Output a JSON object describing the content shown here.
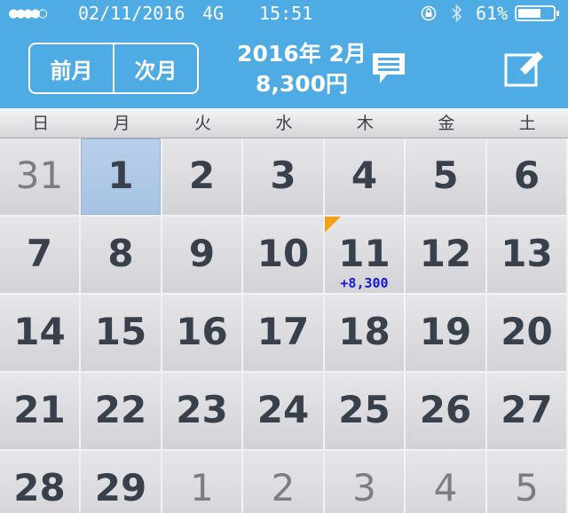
{
  "status_bar": {
    "signal": "●●●●○",
    "date": "02/11/2016",
    "network": "4G",
    "time": "15:51",
    "battery_pct": "61%",
    "icons": [
      "signal-dots-icon",
      "rotation-lock-icon",
      "bluetooth-icon",
      "battery-icon"
    ]
  },
  "header": {
    "prev_label": "前月",
    "next_label": "次月",
    "month_title": "2016年 2月",
    "month_total": "8,300円",
    "icons": [
      "memo-icon",
      "edit-icon"
    ],
    "colors": {
      "background": "#4eabe3",
      "text": "#ffffff"
    }
  },
  "weekdays": [
    "日",
    "月",
    "火",
    "水",
    "木",
    "金",
    "土"
  ],
  "calendar": {
    "selected_day": "1",
    "colors": {
      "selected": "#a6c2e3",
      "amount": "#1616d6",
      "marker": "#f3a218"
    },
    "weeks": [
      [
        {
          "day": "31",
          "muted": true
        },
        {
          "day": "1",
          "selected": true
        },
        {
          "day": "2"
        },
        {
          "day": "3"
        },
        {
          "day": "4"
        },
        {
          "day": "5"
        },
        {
          "day": "6"
        }
      ],
      [
        {
          "day": "7"
        },
        {
          "day": "8"
        },
        {
          "day": "9"
        },
        {
          "day": "10"
        },
        {
          "day": "11",
          "amount": "+8,300",
          "marker": true
        },
        {
          "day": "12"
        },
        {
          "day": "13"
        }
      ],
      [
        {
          "day": "14"
        },
        {
          "day": "15"
        },
        {
          "day": "16"
        },
        {
          "day": "17"
        },
        {
          "day": "18"
        },
        {
          "day": "19"
        },
        {
          "day": "20"
        }
      ],
      [
        {
          "day": "21"
        },
        {
          "day": "22"
        },
        {
          "day": "23"
        },
        {
          "day": "24"
        },
        {
          "day": "25"
        },
        {
          "day": "26"
        },
        {
          "day": "27"
        }
      ],
      [
        {
          "day": "28"
        },
        {
          "day": "29"
        },
        {
          "day": "1",
          "muted": true
        },
        {
          "day": "2",
          "muted": true
        },
        {
          "day": "3",
          "muted": true
        },
        {
          "day": "4",
          "muted": true
        },
        {
          "day": "5",
          "muted": true
        }
      ]
    ]
  }
}
